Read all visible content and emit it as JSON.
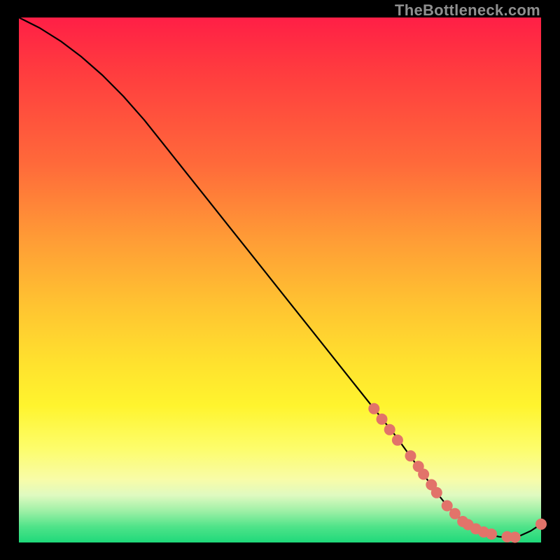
{
  "watermark": "TheBottleneck.com",
  "colors": {
    "frame_bg": "#000000",
    "curve": "#000000",
    "dot": "#e2736a",
    "gradient_top": "#ff1f46",
    "gradient_mid": "#ffe22e",
    "gradient_bottom": "#1fd97a"
  },
  "chart_data": {
    "type": "line",
    "title": "",
    "xlabel": "",
    "ylabel": "",
    "xlim": [
      0,
      100
    ],
    "ylim": [
      0,
      100
    ],
    "grid": false,
    "legend": false,
    "series": [
      {
        "name": "curve",
        "x": [
          0,
          4,
          8,
          12,
          16,
          20,
          24,
          28,
          32,
          36,
          40,
          44,
          48,
          52,
          56,
          60,
          64,
          68,
          72,
          76,
          80,
          82,
          84,
          86,
          88,
          90,
          92,
          94,
          96,
          98,
          100
        ],
        "y": [
          100,
          98,
          95.5,
          92.5,
          89,
          85,
          80.5,
          75.5,
          70.5,
          65.5,
          60.5,
          55.5,
          50.5,
          45.5,
          40.5,
          35.5,
          30.5,
          25.5,
          20.5,
          15,
          9.5,
          7,
          5,
          3.4,
          2.2,
          1.5,
          1.1,
          1.0,
          1.3,
          2.2,
          3.5
        ]
      }
    ],
    "markers": [
      {
        "x": 68,
        "y": 25.5
      },
      {
        "x": 69.5,
        "y": 23.5
      },
      {
        "x": 71,
        "y": 21.5
      },
      {
        "x": 72.5,
        "y": 19.5
      },
      {
        "x": 75,
        "y": 16.5
      },
      {
        "x": 76.5,
        "y": 14.5
      },
      {
        "x": 77.5,
        "y": 13
      },
      {
        "x": 79,
        "y": 11
      },
      {
        "x": 80,
        "y": 9.5
      },
      {
        "x": 82,
        "y": 7
      },
      {
        "x": 83.5,
        "y": 5.5
      },
      {
        "x": 85,
        "y": 4
      },
      {
        "x": 86,
        "y": 3.4
      },
      {
        "x": 87.5,
        "y": 2.6
      },
      {
        "x": 89,
        "y": 2.0
      },
      {
        "x": 90.5,
        "y": 1.6
      },
      {
        "x": 93.5,
        "y": 1.1
      },
      {
        "x": 95,
        "y": 1.0
      },
      {
        "x": 100,
        "y": 3.5
      }
    ]
  }
}
